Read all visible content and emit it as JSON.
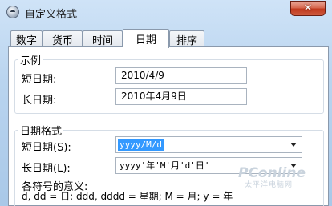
{
  "window": {
    "title": "自定义格式"
  },
  "titlebar": {
    "close_glyph": "✕"
  },
  "tabs": [
    {
      "label": "数字",
      "active": false
    },
    {
      "label": "货币",
      "active": false
    },
    {
      "label": "时间",
      "active": false
    },
    {
      "label": "日期",
      "active": true
    },
    {
      "label": "排序",
      "active": false
    }
  ],
  "example": {
    "group_label": "示例",
    "short_label": "短日期:",
    "short_value": "2010/4/9",
    "long_label": "长日期:",
    "long_value": "2010年4月9日"
  },
  "date_formats": {
    "group_label": "日期格式",
    "short_label": "短日期(S):",
    "short_value": "yyyy/M/d",
    "long_label": "长日期(L):",
    "long_value": "yyyy'年'M'月'd'日'",
    "meaning_title": "各符号的意义:",
    "meaning_text": "d, dd = 日;  ddd, dddd = 星期;  M = 月;  y = 年"
  },
  "watermark": {
    "text": "PConline",
    "subtext": "太平洋电脑网"
  },
  "colors": {
    "selection": "#3399ff",
    "close_button": "#c1391d",
    "frame": "#b9d4ef"
  },
  "icons": {
    "app": "clock-globe-icon",
    "close": "close-icon",
    "dropdown": "chevron-down-icon"
  }
}
